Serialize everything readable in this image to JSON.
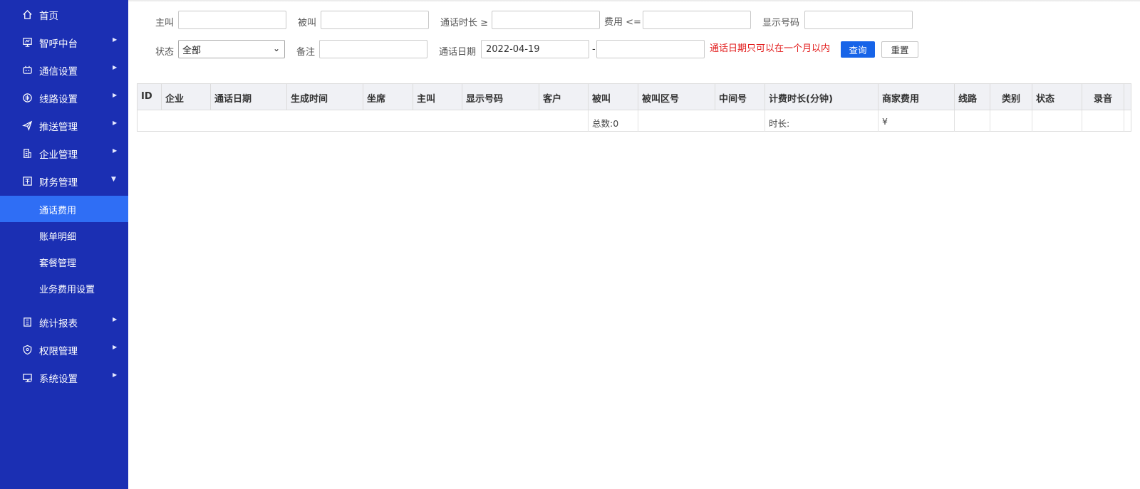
{
  "sidebar": {
    "items": [
      {
        "label": "首页",
        "icon": "home-icon",
        "arrow": ""
      },
      {
        "label": "智呼中台",
        "icon": "monitor-icon",
        "arrow": "right"
      },
      {
        "label": "通信设置",
        "icon": "robot-icon",
        "arrow": "right"
      },
      {
        "label": "线路设置",
        "icon": "signal-icon",
        "arrow": "right"
      },
      {
        "label": "推送管理",
        "icon": "send-icon",
        "arrow": "right"
      },
      {
        "label": "企业管理",
        "icon": "building-icon",
        "arrow": "right"
      },
      {
        "label": "财务管理",
        "icon": "finance-icon",
        "arrow": "down"
      }
    ],
    "sub_items": [
      {
        "label": "通话费用",
        "active": true
      },
      {
        "label": "账单明细",
        "active": false
      },
      {
        "label": "套餐管理",
        "active": false
      },
      {
        "label": "业务费用设置",
        "active": false
      }
    ],
    "items_after": [
      {
        "label": "统计报表",
        "icon": "report-icon",
        "arrow": "right"
      },
      {
        "label": "权限管理",
        "icon": "shield-icon",
        "arrow": "right"
      },
      {
        "label": "系统设置",
        "icon": "settings-icon",
        "arrow": "right"
      }
    ]
  },
  "filters": {
    "caller_label": "主叫",
    "caller_value": "",
    "callee_label": "被叫",
    "callee_value": "",
    "duration_label": "通话时长 ≥",
    "duration_value": "",
    "fee_label": "费用 <=",
    "fee_value": "",
    "display_no_label": "显示号码",
    "display_no_value": "",
    "status_label": "状态",
    "status_selected": "全部",
    "remark_label": "备注",
    "remark_value": "",
    "date_label": "通话日期",
    "date_start": "2022-04-19",
    "date_sep": "-",
    "date_end": "",
    "date_hint": "通话日期只可以在一个月以内",
    "query_button": "查询",
    "reset_button": "重置"
  },
  "table": {
    "columns": [
      "ID",
      "企业",
      "通话日期",
      "生成时间",
      "坐席",
      "主叫",
      "显示号码",
      "客户",
      "被叫",
      "被叫区号",
      "中间号",
      "计费时长(分钟)",
      "商家费用",
      "线路",
      "类别",
      "状态",
      "录音"
    ],
    "summary": {
      "total_count": "总数:0",
      "duration": "时长:",
      "fee": "¥"
    }
  },
  "colors": {
    "sidebar_bg": "#1b2fb3",
    "active_item": "#2f6ef5",
    "primary_button": "#1764e8",
    "hint_red": "#e21b1b",
    "table_header_bg": "#f0f1f5"
  }
}
